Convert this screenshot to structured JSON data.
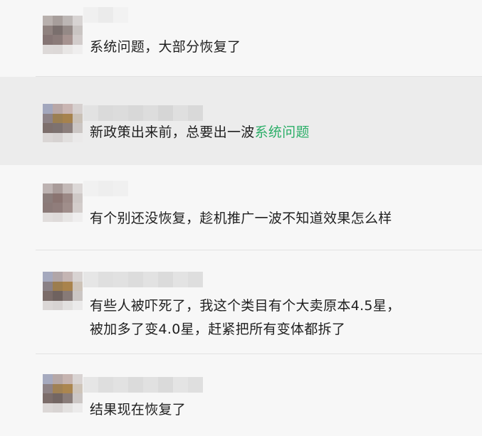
{
  "comments": [
    {
      "text": "系统问题，大部分恢复了",
      "highlight": ""
    },
    {
      "text": "新政策出来前，总要出一波",
      "highlight": "系统问题"
    },
    {
      "text": "有个别还没恢复，趁机推广一波不知道效果怎么样",
      "highlight": ""
    },
    {
      "lines": [
        "有些人被吓死了，我这个类目有个大卖原本4.5星，",
        "被加多了变4.0星，赶紧把所有变体都拆了"
      ]
    },
    {
      "text": "结果现在恢复了",
      "highlight": ""
    }
  ],
  "colors": {
    "background": "#f7f7f7",
    "highlighted_row": "#ececec",
    "keyword": "#2aae67",
    "text": "#1f1f1f"
  }
}
